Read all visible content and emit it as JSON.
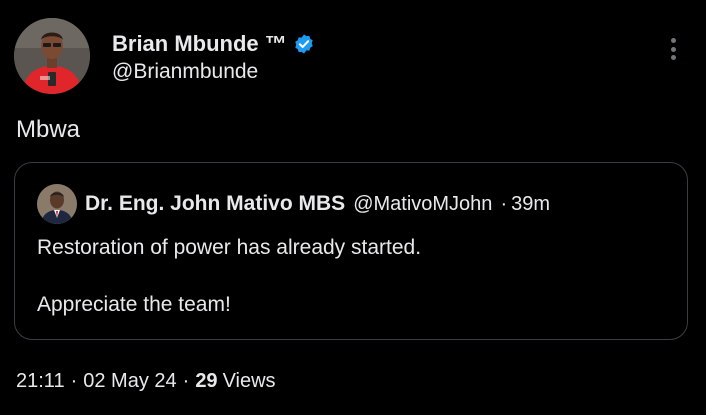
{
  "author": {
    "display_name": "Brian Mbunde ™",
    "handle": "@Brianmbunde",
    "verified_icon": "verified-badge-icon"
  },
  "menu": {
    "icon": "more-options-icon"
  },
  "tweet": {
    "text": "Mbwa"
  },
  "quote": {
    "display_name": "Dr. Eng. John Mativo MBS",
    "handle": "@MativoMJohn",
    "separator": "·",
    "time": "39m",
    "text_line1": "Restoration of power has already started.",
    "text_line2": "Appreciate the team!"
  },
  "meta": {
    "time": "21:11",
    "separator": "·",
    "date": "02 May 24",
    "views_count": "29",
    "views_label": "Views"
  },
  "colors": {
    "background": "#000000",
    "text": "#e7e9ea",
    "verified": "#1d9bf0",
    "border": "#3a3d41",
    "muted": "#71767b"
  }
}
